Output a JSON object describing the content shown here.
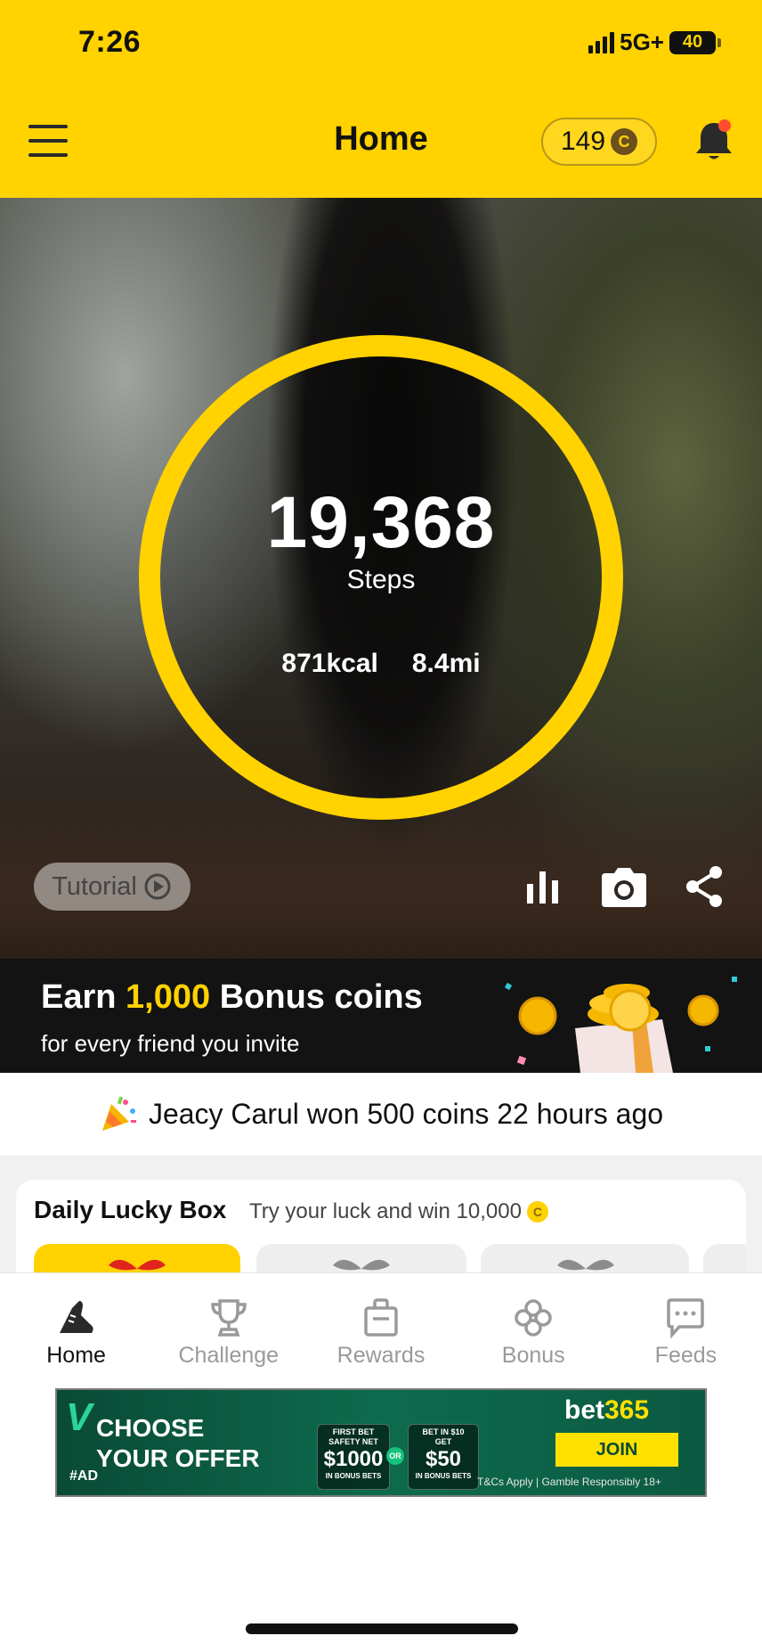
{
  "status_bar": {
    "time": "7:26",
    "network": "5G+",
    "battery": "40"
  },
  "header": {
    "title": "Home",
    "coin_balance": "149",
    "coin_symbol": "C"
  },
  "tracker": {
    "steps": "19,368",
    "steps_label": "Steps",
    "calories": "871kcal",
    "distance": "8.4mi",
    "ring_color": "#FFD200",
    "tutorial_label": "Tutorial"
  },
  "referral": {
    "prefix": "Earn ",
    "amount": "1,000",
    "suffix": " Bonus coins",
    "subtitle": "for every friend you invite"
  },
  "ticker": {
    "message": "Jeacy Carul won 500 coins 22 hours ago"
  },
  "lucky_box": {
    "title": "Daily Lucky Box",
    "subtitle": "Try your luck and win 10,000"
  },
  "bottom_nav": [
    {
      "label": "Home",
      "icon": "shoe-icon",
      "active": true
    },
    {
      "label": "Challenge",
      "icon": "trophy-icon"
    },
    {
      "label": "Rewards",
      "icon": "shopping-bag-icon"
    },
    {
      "label": "Bonus",
      "icon": "clover-icon"
    },
    {
      "label": "Feeds",
      "icon": "chat-icon"
    }
  ],
  "ad": {
    "headline": "CHOOSE\nYOUR OFFER",
    "tag": "#AD",
    "offer1_top": "FIRST BET\nSAFETY NET",
    "offer1_amount": "$1000",
    "offer1_foot": "IN BONUS BETS",
    "or": "OR",
    "offer2_top": "BET IN $10\nGET",
    "offer2_amount": "$50",
    "offer2_foot": "IN BONUS BETS",
    "brand_prefix": "bet",
    "brand_suffix": "365",
    "join": "JOIN",
    "terms": "T&Cs Apply | Gamble Responsibly 18+"
  },
  "colors": {
    "brand_yellow": "#FFD200",
    "banner_dark": "#131313"
  }
}
